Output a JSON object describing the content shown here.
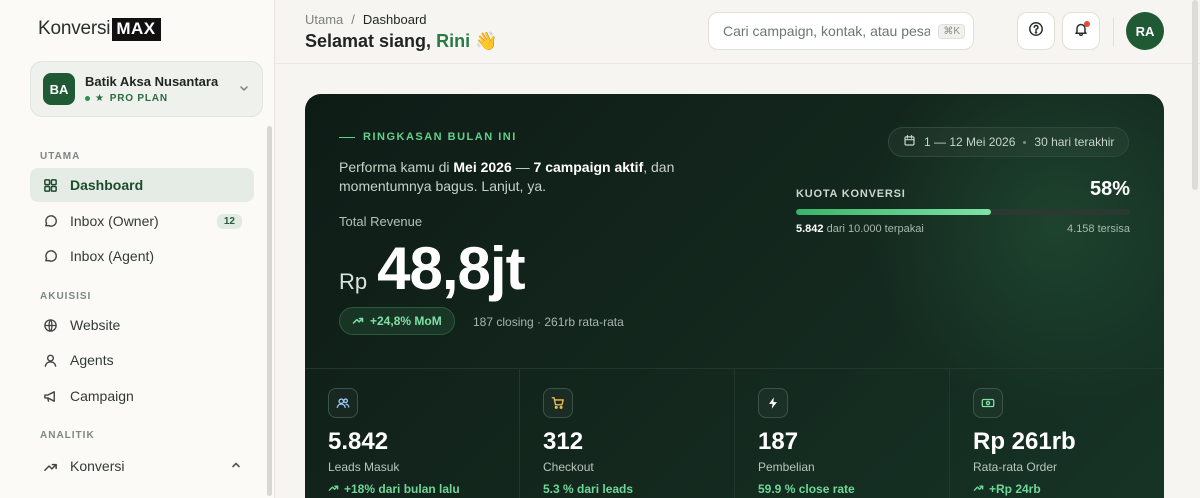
{
  "brand": {
    "name": "Konversi",
    "max": "MAX"
  },
  "org": {
    "initials": "BA",
    "name": "Batik Aksa Nusantara",
    "plan": "PRO PLAN"
  },
  "sidebar": {
    "sections": [
      {
        "label": "UTAMA"
      },
      {
        "label": "AKUISISI"
      },
      {
        "label": "ANALITIK"
      }
    ],
    "items": [
      {
        "label": "Dashboard",
        "icon": "grid-icon"
      },
      {
        "label": "Inbox (Owner)",
        "icon": "chat-bubble-icon",
        "badge": "12"
      },
      {
        "label": "Inbox (Agent)",
        "icon": "chat-bubble-icon"
      },
      {
        "label": "Website",
        "icon": "globe-icon"
      },
      {
        "label": "Agents",
        "icon": "user-icon"
      },
      {
        "label": "Campaign",
        "icon": "megaphone-icon"
      },
      {
        "label": "Konversi",
        "icon": "trend-up-icon"
      }
    ]
  },
  "header": {
    "breadcrumb": [
      "Utama",
      "Dashboard"
    ],
    "breadcrumb_sep": "/",
    "greeting_prefix": "Selamat siang,",
    "greeting_name": "Rini",
    "greeting_emoji": "👋",
    "search_placeholder": "Cari campaign, kontak, atau pesan",
    "search_shortcut": "⌘K",
    "user_initials": "RA"
  },
  "hero": {
    "eyebrow": "RINGKASAN BULAN INI",
    "perf_prefix": "Performa kamu di ",
    "perf_month": "Mei 2026",
    "perf_mid": " — ",
    "perf_active": "7 campaign aktif",
    "perf_suffix": ", dan momentumnya bagus. Lanjut, ya.",
    "revenue_label": "Total Revenue",
    "currency": "Rp",
    "revenue_value": "48,8jt",
    "mom_badge": "+24,8% MoM",
    "mom_note": "187 closing · 261rb rata-rata",
    "date_range": "1 — 12 Mei 2026",
    "date_period": "30 hari terakhir",
    "quota_label": "KUOTA KONVERSI",
    "quota_pct": "58%",
    "quota_fraction": 0.5842,
    "quota_used": "5.842",
    "quota_used_suffix": " dari 10.000 terpakai",
    "quota_remaining": "4.158 tersisa"
  },
  "stats": [
    {
      "icon": "users-icon",
      "value": "5.842",
      "label": "Leads Masuk",
      "delta": "+18% dari bulan lalu"
    },
    {
      "icon": "cart-icon",
      "value": "312",
      "label": "Checkout",
      "delta": "5.3  % dari leads"
    },
    {
      "icon": "bolt-icon",
      "value": "187",
      "label": "Pembelian",
      "delta": "59.9  % close rate"
    },
    {
      "icon": "cash-icon",
      "value": "Rp 261rb",
      "label": "Rata-rata Order",
      "delta": "+Rp 24rb"
    }
  ],
  "colors": {
    "accent": "#2a7a45",
    "hero_bg": "#0e1c16",
    "positive": "#6fd797"
  }
}
